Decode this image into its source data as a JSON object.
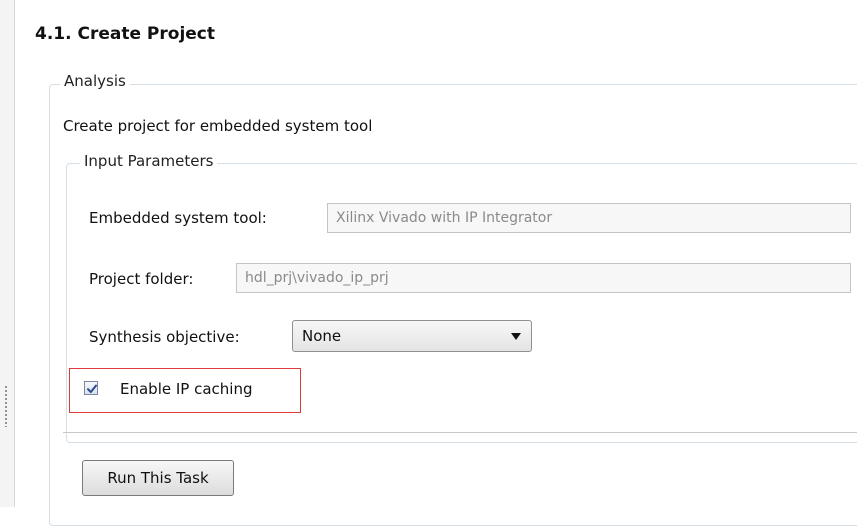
{
  "page": {
    "title": "4.1. Create Project"
  },
  "analysis": {
    "legend": "Analysis",
    "description": "Create project for embedded system tool"
  },
  "input_parameters": {
    "legend": "Input Parameters",
    "embedded_tool": {
      "label": "Embedded system tool:",
      "value": "Xilinx Vivado with IP Integrator"
    },
    "project_folder": {
      "label": "Project folder:",
      "value": "hdl_prj\\vivado_ip_prj"
    },
    "synthesis_objective": {
      "label": "Synthesis objective:",
      "value": "None"
    },
    "ip_caching": {
      "label": "Enable IP caching",
      "checked": true
    }
  },
  "actions": {
    "run_label": "Run This Task"
  },
  "icons": {
    "checkbox_mark": "checkmark-icon",
    "dropdown_arrow": "chevron-down-icon",
    "panel_grip": "grip-icon"
  },
  "colors": {
    "highlight_border": "#e03b3b",
    "checkmark": "#2d4a8a",
    "group_border": "#d5dfe5"
  }
}
